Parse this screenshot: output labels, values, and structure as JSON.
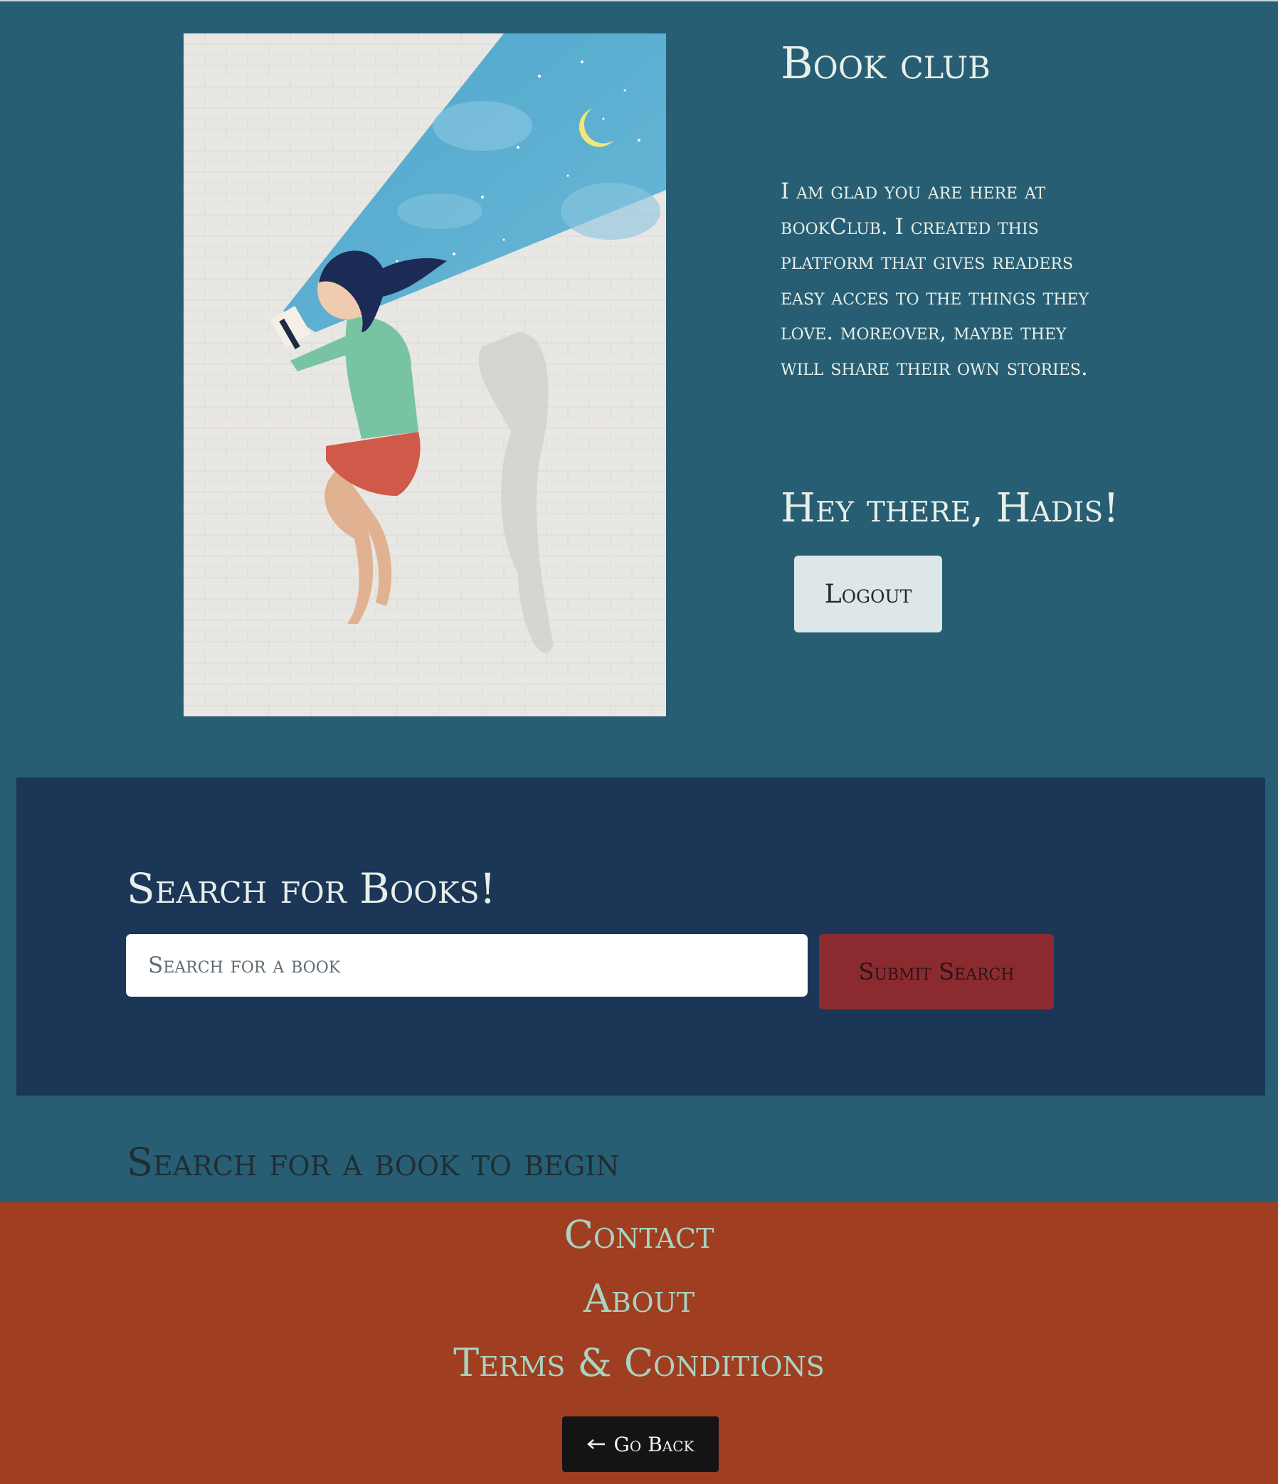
{
  "header": {
    "title": "Book club",
    "intro": "I am glad you are here at bookClub. I created this platform that gives readers easy acces to the things they love. moreover, maybe they will share their own stories.",
    "greeting": "Hey there, Hadis!",
    "logout_label": "Logout"
  },
  "search": {
    "heading": "Search for Books!",
    "placeholder": "Search for a book",
    "submit_label": "Submit Search",
    "empty_state": "Search for a book to begin"
  },
  "footer": {
    "links": [
      "Contact",
      "About",
      "Terms & Conditions"
    ],
    "back_label": "Go Back",
    "back_icon": "arrow-left-icon"
  },
  "colors": {
    "page_bg": "#275e73",
    "search_band": "#1b3657",
    "submit": "#8b2b2f",
    "footer": "#a03e22",
    "footer_link": "#a9d3c0"
  }
}
